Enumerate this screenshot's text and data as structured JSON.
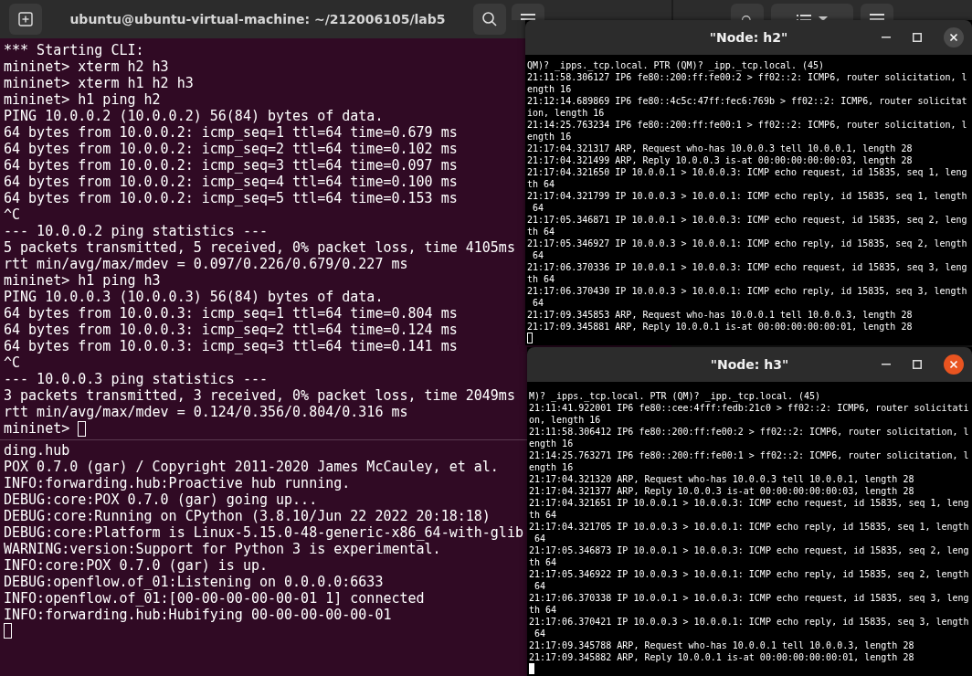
{
  "main_terminal": {
    "title": "ubuntu@ubuntu-virtual-machine: ~/212006105/lab5",
    "focused": false,
    "top_pane": [
      "*** Starting CLI:",
      "mininet> xterm h2 h3",
      "mininet> xterm h1 h2 h3",
      "mininet> h1 ping h2",
      "PING 10.0.0.2 (10.0.0.2) 56(84) bytes of data.",
      "64 bytes from 10.0.0.2: icmp_seq=1 ttl=64 time=0.679 ms",
      "64 bytes from 10.0.0.2: icmp_seq=2 ttl=64 time=0.102 ms",
      "64 bytes from 10.0.0.2: icmp_seq=3 ttl=64 time=0.097 ms",
      "64 bytes from 10.0.0.2: icmp_seq=4 ttl=64 time=0.100 ms",
      "64 bytes from 10.0.0.2: icmp_seq=5 ttl=64 time=0.153 ms",
      "^C",
      "--- 10.0.0.2 ping statistics ---",
      "5 packets transmitted, 5 received, 0% packet loss, time 4105ms",
      "rtt min/avg/max/mdev = 0.097/0.226/0.679/0.227 ms",
      "mininet> h1 ping h3",
      "PING 10.0.0.3 (10.0.0.3) 56(84) bytes of data.",
      "64 bytes from 10.0.0.3: icmp_seq=1 ttl=64 time=0.804 ms",
      "64 bytes from 10.0.0.3: icmp_seq=2 ttl=64 time=0.124 ms",
      "64 bytes from 10.0.0.3: icmp_seq=3 ttl=64 time=0.141 ms",
      "^C",
      "--- 10.0.0.3 ping statistics ---",
      "3 packets transmitted, 3 received, 0% packet loss, time 2049ms",
      "rtt min/avg/max/mdev = 0.124/0.356/0.804/0.316 ms"
    ],
    "top_prompt": "mininet>",
    "bottom_pane": [
      "ding.hub",
      "POX 0.7.0 (gar) / Copyright 2011-2020 James McCauley, et al.",
      "INFO:forwarding.hub:Proactive hub running.",
      "DEBUG:core:POX 0.7.0 (gar) going up...",
      "DEBUG:core:Running on CPython (3.8.10/Jun 22 2022 20:18:18)",
      "DEBUG:core:Platform is Linux-5.15.0-48-generic-x86_64-with-glib",
      "WARNING:version:Support for Python 3 is experimental.",
      "INFO:core:POX 0.7.0 (gar) is up.",
      "DEBUG:openflow.of_01:Listening on 0.0.0.0:6633",
      "INFO:openflow.of_01:[00-00-00-00-00-01 1] connected",
      "INFO:forwarding.hub:Hubifying 00-00-00-00-00-01"
    ]
  },
  "xterm_windows": [
    {
      "title": "\"Node: h2\"",
      "focused": false,
      "lines": [
        "QM)? _ipps._tcp.local. PTR (QM)? _ipp._tcp.local. (45)",
        "21:11:58.306127 IP6 fe80::200:ff:fe00:2 > ff02::2: ICMP6, router solicitation, l",
        "ength 16",
        "21:12:14.689869 IP6 fe80::4c5c:47ff:fec6:769b > ff02::2: ICMP6, router solicitat",
        "ion, length 16",
        "21:14:25.763234 IP6 fe80::200:ff:fe00:1 > ff02::2: ICMP6, router solicitation, l",
        "ength 16",
        "21:17:04.321317 ARP, Request who-has 10.0.0.3 tell 10.0.0.1, length 28",
        "21:17:04.321499 ARP, Reply 10.0.0.3 is-at 00:00:00:00:00:03, length 28",
        "21:17:04.321650 IP 10.0.0.1 > 10.0.0.3: ICMP echo request, id 15835, seq 1, leng",
        "th 64",
        "21:17:04.321799 IP 10.0.0.3 > 10.0.0.1: ICMP echo reply, id 15835, seq 1, length",
        " 64",
        "21:17:05.346871 IP 10.0.0.1 > 10.0.0.3: ICMP echo request, id 15835, seq 2, leng",
        "th 64",
        "21:17:05.346927 IP 10.0.0.3 > 10.0.0.1: ICMP echo reply, id 15835, seq 2, length",
        " 64",
        "21:17:06.370336 IP 10.0.0.1 > 10.0.0.3: ICMP echo request, id 15835, seq 3, leng",
        "th 64",
        "21:17:06.370430 IP 10.0.0.3 > 10.0.0.1: ICMP echo reply, id 15835, seq 3, length",
        " 64",
        "21:17:09.345853 ARP, Request who-has 10.0.0.1 tell 10.0.0.3, length 28",
        "21:17:09.345881 ARP, Reply 10.0.0.1 is-at 00:00:00:00:00:01, length 28"
      ]
    },
    {
      "title": "\"Node: h3\"",
      "focused": true,
      "lines": [
        "M)? _ipps._tcp.local. PTR (QM)? _ipp._tcp.local. (45)",
        "21:11:41.922001 IP6 fe80::cee:4fff:fedb:21c0 > ff02::2: ICMP6, router solicitati",
        "on, length 16",
        "21:11:58.306412 IP6 fe80::200:ff:fe00:2 > ff02::2: ICMP6, router solicitation, l",
        "ength 16",
        "21:14:25.763271 IP6 fe80::200:ff:fe00:1 > ff02::2: ICMP6, router solicitation, l",
        "ength 16",
        "21:17:04.321320 ARP, Request who-has 10.0.0.3 tell 10.0.0.1, length 28",
        "21:17:04.321377 ARP, Reply 10.0.0.3 is-at 00:00:00:00:00:03, length 28",
        "21:17:04.321651 IP 10.0.0.1 > 10.0.0.3: ICMP echo request, id 15835, seq 1, leng",
        "th 64",
        "21:17:04.321705 IP 10.0.0.3 > 10.0.0.1: ICMP echo reply, id 15835, seq 1, length",
        " 64",
        "21:17:05.346873 IP 10.0.0.1 > 10.0.0.3: ICMP echo request, id 15835, seq 2, leng",
        "th 64",
        "21:17:05.346922 IP 10.0.0.3 > 10.0.0.1: ICMP echo reply, id 15835, seq 2, length",
        " 64",
        "21:17:06.370338 IP 10.0.0.1 > 10.0.0.3: ICMP echo request, id 15835, seq 3, leng",
        "th 64",
        "21:17:06.370421 IP 10.0.0.3 > 10.0.0.1: ICMP echo reply, id 15835, seq 3, length",
        " 64",
        "21:17:09.345788 ARP, Request who-has 10.0.0.1 tell 10.0.0.3, length 28",
        "21:17:09.345882 ARP, Reply 10.0.0.1 is-at 00:00:00:00:00:01, length 28"
      ]
    }
  ]
}
